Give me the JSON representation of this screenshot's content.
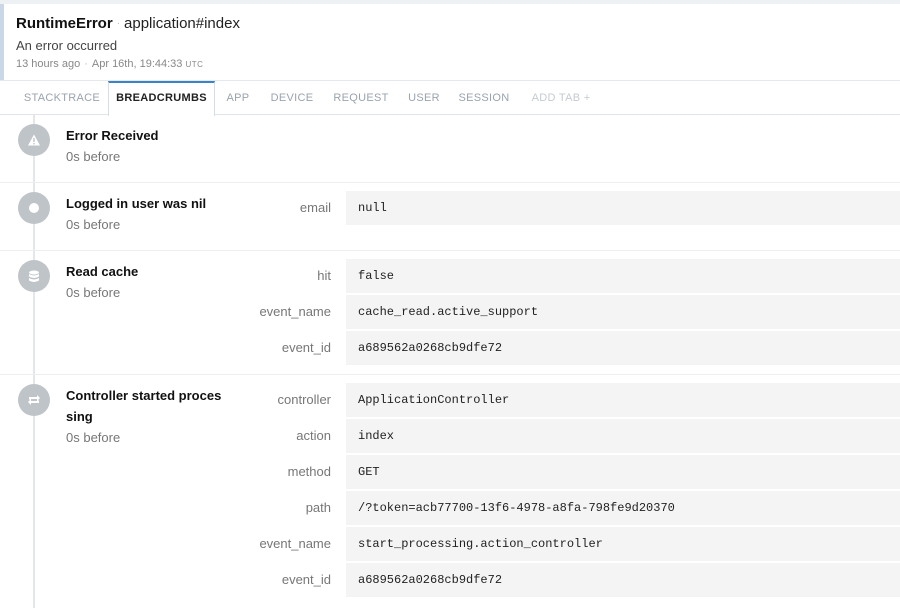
{
  "error": {
    "class": "RuntimeError",
    "context": "application#index",
    "message": "An error occurred",
    "relative_time": "13 hours ago",
    "timestamp": "Apr 16th, 19:44:33",
    "timezone": "UTC"
  },
  "tabs": [
    {
      "label": "STACKTRACE",
      "active": false
    },
    {
      "label": "BREADCRUMBS",
      "active": true
    },
    {
      "label": "APP",
      "active": false
    },
    {
      "label": "DEVICE",
      "active": false
    },
    {
      "label": "REQUEST",
      "active": false
    },
    {
      "label": "USER",
      "active": false
    },
    {
      "label": "SESSION",
      "active": false
    },
    {
      "label": "ADD TAB +",
      "active": false
    }
  ],
  "breadcrumbs": [
    {
      "icon": "warning-icon",
      "title": "Error Received",
      "time": "0s before",
      "metadata": []
    },
    {
      "icon": "circle-dot-icon",
      "title": "Logged in user was nil",
      "time": "0s before",
      "metadata": [
        {
          "key": "email",
          "value": "null"
        }
      ]
    },
    {
      "icon": "database-icon",
      "title": "Read cache",
      "time": "0s before",
      "metadata": [
        {
          "key": "hit",
          "value": "false"
        },
        {
          "key": "event_name",
          "value": "cache_read.active_support"
        },
        {
          "key": "event_id",
          "value": "a689562a0268cb9dfe72"
        }
      ]
    },
    {
      "icon": "refresh-icon",
      "title": "Controller started processing",
      "time": "0s before",
      "metadata": [
        {
          "key": "controller",
          "value": "ApplicationController"
        },
        {
          "key": "action",
          "value": "index"
        },
        {
          "key": "method",
          "value": "GET"
        },
        {
          "key": "path",
          "value": "/?token=acb77700-13f6-4978-a8fa-798fe9d20370"
        },
        {
          "key": "event_name",
          "value": "start_processing.action_controller"
        },
        {
          "key": "event_id",
          "value": "a689562a0268cb9dfe72"
        }
      ]
    }
  ]
}
